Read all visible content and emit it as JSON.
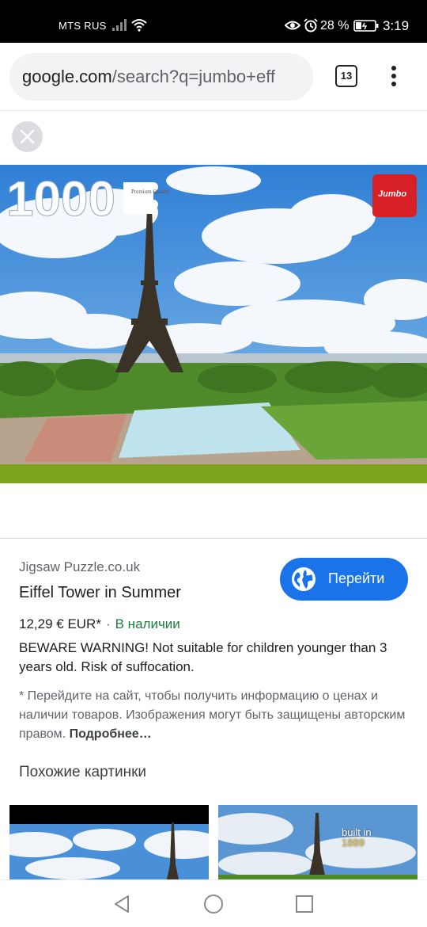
{
  "status_bar": {
    "carrier": "MTS RUS",
    "battery_percent": "28 %",
    "time": "3:19"
  },
  "browser": {
    "url_host": "google.com",
    "url_path": "/search?q=jumbo+eff",
    "tab_count": "13"
  },
  "image": {
    "piece_count": "1000",
    "quality_badge": "Premium Quality",
    "brand_logo": "Jumbo"
  },
  "result": {
    "source": "Jigsaw Puzzle.co.uk",
    "title": "Eiffel Tower in Summer",
    "visit_button": "Перейти",
    "price": "12,29 € EUR*",
    "separator": "·",
    "availability": "В наличии",
    "warning": "BEWARE WARNING! Not suitable for children younger than 3 years old. Risk of suffocation.",
    "notice": "* Перейдите на сайт, чтобы получить информацию о ценах и наличии товаров. Изображения могут быть защищены авторским правом.",
    "more_link": "Подробнее…"
  },
  "related": {
    "heading": "Похожие картинки",
    "thumb2_caption_line1": "built in",
    "thumb2_caption_line2": "1889"
  },
  "icons": {
    "close": "close-icon",
    "globe": "globe-icon",
    "menu": "more-vert-icon",
    "back": "back-icon",
    "home": "home-icon",
    "recent": "recent-apps-icon"
  },
  "colors": {
    "accent": "#1a73e8",
    "in_stock": "#188038",
    "status_bar_bg": "#000000"
  }
}
